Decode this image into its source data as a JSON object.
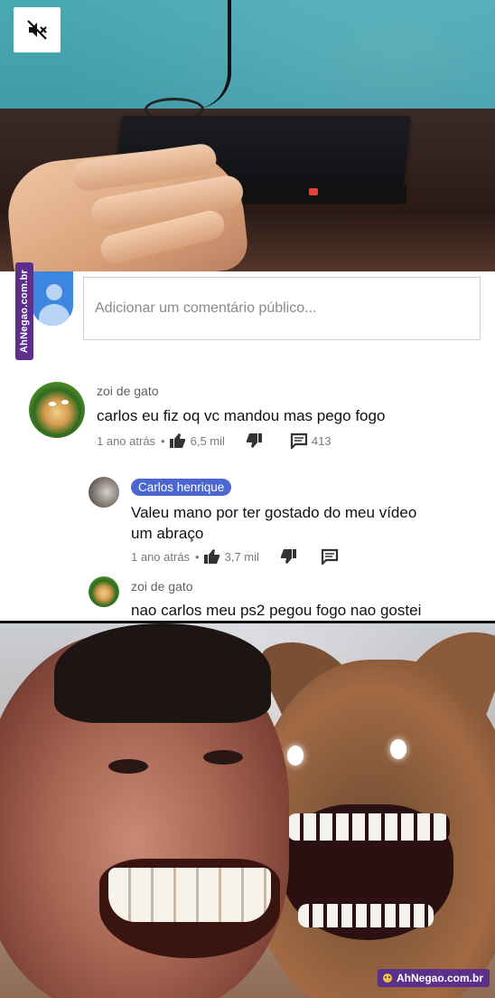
{
  "watermark": {
    "side_text": "AhNegao.com.br",
    "bottom_text": "AhNegao.com.br"
  },
  "add_comment": {
    "placeholder": "Adicionar um comentário público..."
  },
  "comments": [
    {
      "author": "zoi de gato",
      "text": "carlos eu fiz oq vc mandou mas pego fogo",
      "time": "1 ano atrás",
      "likes": "6,5 mil",
      "replies": "413"
    },
    {
      "author": "Carlos henrique",
      "text_line1": "Valeu mano por ter gostado do meu vídeo",
      "text_line2": "um abraço",
      "time": "1 ano atrás",
      "likes": "3,7 mil"
    },
    {
      "author": "zoi de gato",
      "text": "nao carlos meu ps2 pegou fogo nao gostei"
    }
  ],
  "colors": {
    "channel_badge": "#4a66d0",
    "watermark": "#5b2f8a",
    "meta_gray": "#7a7a7a"
  },
  "icons": [
    "mute-icon",
    "thumbs-up-icon",
    "thumbs-down-icon",
    "reply-comment-icon",
    "default-avatar-icon"
  ]
}
